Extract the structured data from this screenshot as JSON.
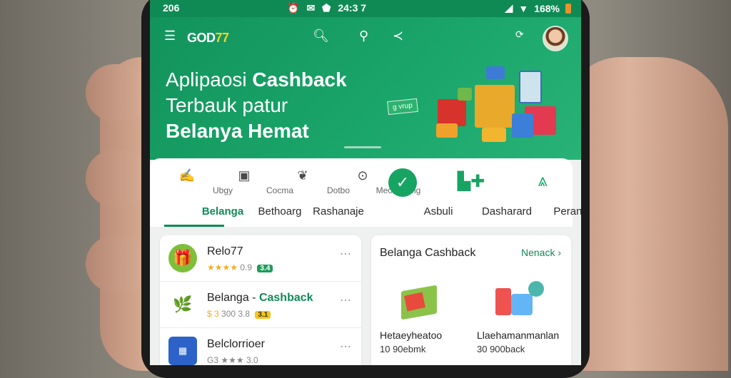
{
  "status_bar": {
    "time": "206",
    "center": "24:3 7",
    "battery": "168%"
  },
  "header": {
    "brand_main": "GOD",
    "brand_accent": "77"
  },
  "hero": {
    "line1_prefix": "Aplipaosi ",
    "line1_bold": "Cashback",
    "line2": "Terbauk patur",
    "line3": "Belanya Hemat",
    "tag": "g vrup"
  },
  "tabs": [
    {
      "sub": "Ubgy",
      "label": "Belanga",
      "icon": "tag-icon"
    },
    {
      "sub": "Cocma",
      "label": "Bethoarg",
      "icon": "store-icon"
    },
    {
      "sub": "Dotbo",
      "label": "Rashanaje",
      "icon": "leaf-icon"
    },
    {
      "sub": "Meoetloang",
      "label": "Asbuli",
      "icon": "clock-icon"
    },
    {
      "sub": "",
      "label": "Dasharard",
      "icon": "check-circle-icon"
    },
    {
      "sub": "",
      "label": "Peranoors",
      "icon": "dashboard-icon"
    }
  ],
  "list": [
    {
      "title": "Relo77",
      "title_suffix": "",
      "stars": "★★★★",
      "rating": "0.9",
      "badge": "3.4"
    },
    {
      "title": "Belanga - ",
      "title_suffix": "Cashback",
      "stars": "$ 3",
      "rating": "300 3.8",
      "badge": "3.1"
    },
    {
      "title": "Belclorrioer",
      "title_suffix": "",
      "stars": "G3 ★★★",
      "rating": "3.0",
      "badge": ""
    }
  ],
  "promo": {
    "title": "Belanga Cashback",
    "link": "Nenack",
    "items": [
      {
        "name": "Hetaeyheatoo",
        "price": "10 90ebmk"
      },
      {
        "name": "Llaehamanmanlan",
        "price": "30 900back"
      }
    ]
  },
  "colors": {
    "primary": "#0f8a55",
    "accent": "#f2d22e"
  }
}
